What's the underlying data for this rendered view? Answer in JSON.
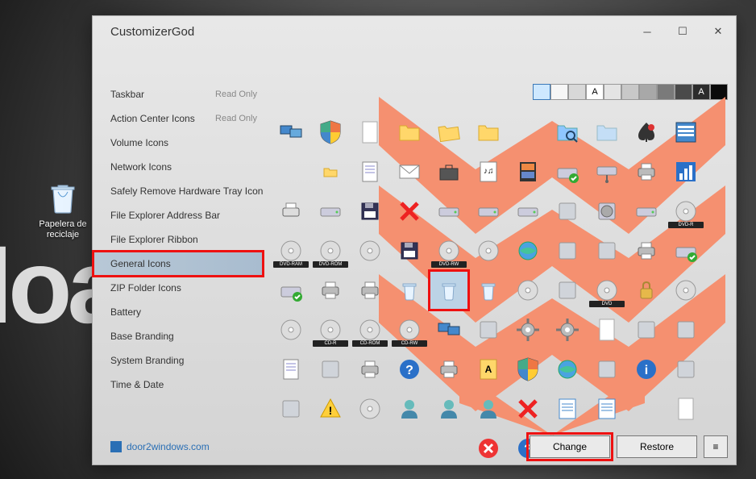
{
  "desktop": {
    "recycle_bin_label_1": "Papelera de",
    "recycle_bin_label_2": "reciclaje",
    "bg_text": "loa"
  },
  "window": {
    "title": "CustomizerGod",
    "sidebar": {
      "items": [
        {
          "label": "Taskbar",
          "readonly": "Read Only"
        },
        {
          "label": "Action Center Icons",
          "readonly": "Read Only"
        },
        {
          "label": "Volume Icons",
          "readonly": ""
        },
        {
          "label": "Network Icons",
          "readonly": ""
        },
        {
          "label": "Safely Remove Hardware Tray Icon",
          "readonly": ""
        },
        {
          "label": "File Explorer Address Bar",
          "readonly": ""
        },
        {
          "label": "File Explorer Ribbon",
          "readonly": ""
        },
        {
          "label": "General Icons",
          "readonly": ""
        },
        {
          "label": "ZIP Folder Icons",
          "readonly": ""
        },
        {
          "label": "Battery",
          "readonly": ""
        },
        {
          "label": "Base Branding",
          "readonly": ""
        },
        {
          "label": "System Branding",
          "readonly": ""
        },
        {
          "label": "Time & Date",
          "readonly": ""
        }
      ],
      "selected_index": 7
    },
    "swatches": [
      {
        "bg": "#cee8ff",
        "border": "#3a78b8",
        "txt": ""
      },
      {
        "bg": "#f6f6f6",
        "txt": ""
      },
      {
        "bg": "#d8d8d8",
        "txt": ""
      },
      {
        "bg": "#ffffff",
        "txt": "A"
      },
      {
        "bg": "#e4e4e4",
        "txt": ""
      },
      {
        "bg": "#c8c8c8",
        "txt": ""
      },
      {
        "bg": "#a8a8a8",
        "txt": ""
      },
      {
        "bg": "#7a7a7a",
        "txt": ""
      },
      {
        "bg": "#4a4a4a",
        "txt": ""
      },
      {
        "bg": "#2c2c2c",
        "txt": "A"
      },
      {
        "bg": "#0a0a0a",
        "txt": ""
      }
    ],
    "icons": [
      {
        "name": "displays-icon"
      },
      {
        "name": "shield-icon"
      },
      {
        "name": "document-icon"
      },
      {
        "name": "folder-icon"
      },
      {
        "name": "folder-tilted-icon"
      },
      {
        "name": "folder-yellow-icon"
      },
      {
        "name": "empty"
      },
      {
        "name": "folder-search-icon"
      },
      {
        "name": "folder-translucent-icon"
      },
      {
        "name": "spade-icon"
      },
      {
        "name": "window-list-icon"
      },
      {
        "name": "empty"
      },
      {
        "name": "folder-small-icon"
      },
      {
        "name": "notepad-icon"
      },
      {
        "name": "envelope-icon"
      },
      {
        "name": "toolbox-icon"
      },
      {
        "name": "music-score-icon"
      },
      {
        "name": "film-strip-icon"
      },
      {
        "name": "drive-check-icon"
      },
      {
        "name": "network-drive-icon"
      },
      {
        "name": "printer-icon"
      },
      {
        "name": "chart-icon"
      },
      {
        "name": "printer2-icon"
      },
      {
        "name": "drive-icon"
      },
      {
        "name": "floppy-icon"
      },
      {
        "name": "x-red-icon"
      },
      {
        "name": "dark-drive-icon"
      },
      {
        "name": "dark-drive2-icon"
      },
      {
        "name": "drive2-icon"
      },
      {
        "name": "window-flag-icon"
      },
      {
        "name": "hdd-icon"
      },
      {
        "name": "drive3-icon"
      },
      {
        "name": "dvd-r-icon",
        "tag": "DVD-R"
      },
      {
        "name": "dvd-ram-icon",
        "tag": "DVD-RAM"
      },
      {
        "name": "dvd-rom-icon",
        "tag": "DVD-ROM"
      },
      {
        "name": "disc-icon"
      },
      {
        "name": "floppy2-icon"
      },
      {
        "name": "dvd-rw-icon",
        "tag": "DVD-RW"
      },
      {
        "name": "disc2-icon"
      },
      {
        "name": "globe-icon"
      },
      {
        "name": "box-icon"
      },
      {
        "name": "camera-icon"
      },
      {
        "name": "printer-check-icon"
      },
      {
        "name": "disc-check-icon"
      },
      {
        "name": "drive-check2-icon"
      },
      {
        "name": "printer-check2-icon"
      },
      {
        "name": "printer-check3-icon"
      },
      {
        "name": "recycle-bin-group-icon"
      },
      {
        "name": "recycle-bin-icon",
        "selected": true
      },
      {
        "name": "recycle-tiny-icon"
      },
      {
        "name": "disc3-icon"
      },
      {
        "name": "camera2-icon"
      },
      {
        "name": "dvd-icon",
        "tag": "DVD"
      },
      {
        "name": "lock-icon"
      },
      {
        "name": "disc4-icon"
      },
      {
        "name": "disc5-icon"
      },
      {
        "name": "cd-r-icon",
        "tag": "CD-R"
      },
      {
        "name": "cd-rom-icon",
        "tag": "CD-ROM"
      },
      {
        "name": "cd-rw-icon",
        "tag": "CD-RW"
      },
      {
        "name": "monitors-icon"
      },
      {
        "name": "mp3-player-icon"
      },
      {
        "name": "gear-icon"
      },
      {
        "name": "gears-icon"
      },
      {
        "name": "blank-doc-icon"
      },
      {
        "name": "photo-icon"
      },
      {
        "name": "landscape-icon"
      },
      {
        "name": "doc-lines-icon"
      },
      {
        "name": "phone-icon"
      },
      {
        "name": "printer3-icon"
      },
      {
        "name": "help-icon"
      },
      {
        "name": "printer4-icon"
      },
      {
        "name": "a-flag-icon"
      },
      {
        "name": "shield2-icon"
      },
      {
        "name": "globe-stand-icon"
      },
      {
        "name": "servers-icon"
      },
      {
        "name": "info-icon"
      },
      {
        "name": "sunflower-icon"
      },
      {
        "name": "flower-icon"
      },
      {
        "name": "warning-icon"
      },
      {
        "name": "disc6-icon"
      },
      {
        "name": "user-icon"
      },
      {
        "name": "users-icon"
      },
      {
        "name": "user-shield-icon"
      },
      {
        "name": "x-red2-icon"
      },
      {
        "name": "list-icon"
      },
      {
        "name": "list2-icon"
      },
      {
        "name": "empty"
      },
      {
        "name": "blank-page-icon"
      },
      {
        "name": "empty"
      },
      {
        "name": "empty"
      },
      {
        "name": "empty"
      },
      {
        "name": "empty"
      },
      {
        "name": "empty"
      },
      {
        "name": "close-red-icon"
      },
      {
        "name": "question-icon"
      }
    ],
    "footer": {
      "link": "door2windows.com",
      "change_btn": "Change",
      "restore_btn": "Restore",
      "menu_btn": "≡"
    }
  }
}
